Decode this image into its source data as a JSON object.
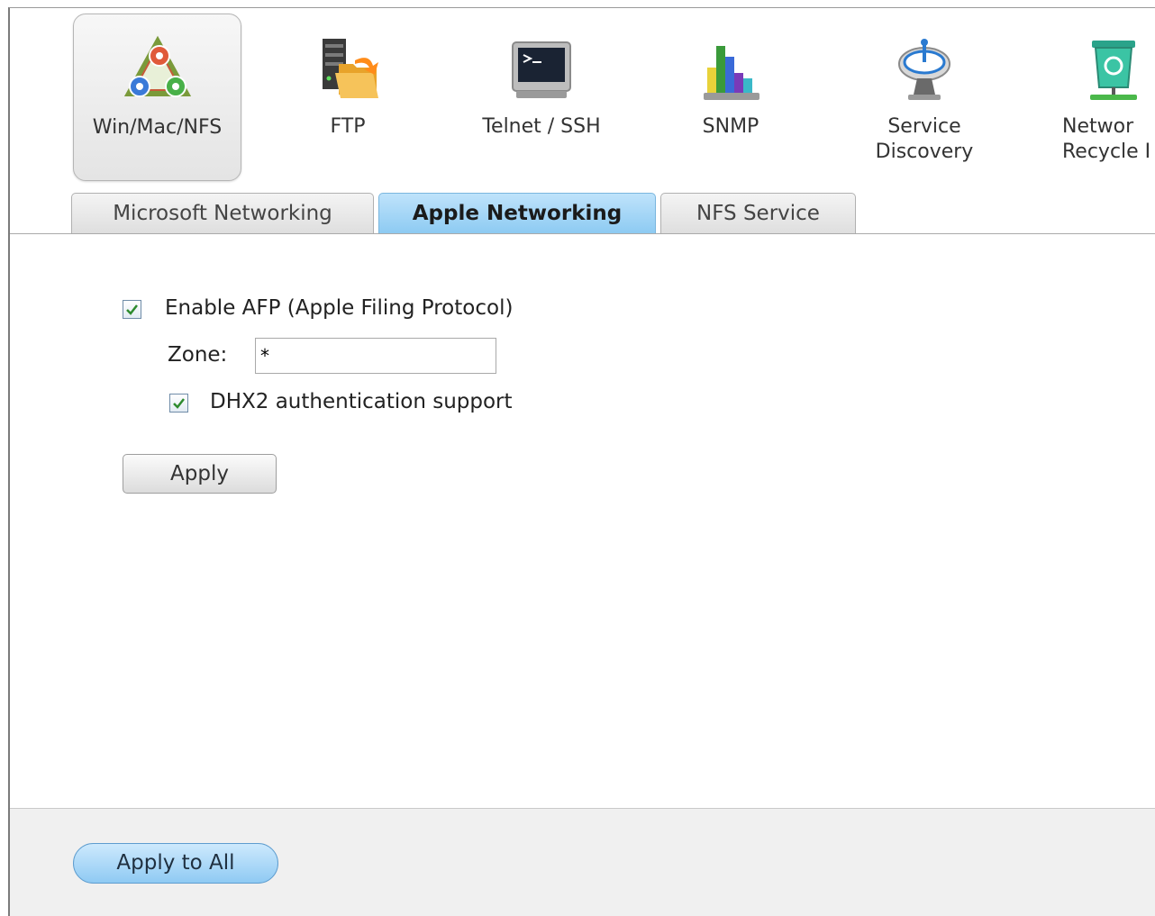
{
  "services": [
    {
      "label": "Win/Mac/NFS",
      "icon": "win-mac-nfs-icon",
      "selected": true
    },
    {
      "label": "FTP",
      "icon": "ftp-folder-icon"
    },
    {
      "label": "Telnet / SSH",
      "icon": "terminal-icon"
    },
    {
      "label": "SNMP",
      "icon": "bar-chart-icon"
    },
    {
      "label": "Service\nDiscovery",
      "icon": "satellite-dish-icon"
    },
    {
      "label": "Networ\nRecycle I",
      "icon": "recycle-bin-icon"
    }
  ],
  "tabs": [
    {
      "label": "Microsoft Networking"
    },
    {
      "label": "Apple Networking",
      "active": true
    },
    {
      "label": "NFS Service"
    }
  ],
  "afp": {
    "enable_label": "Enable AFP (Apple Filing Protocol)",
    "enable_checked": true,
    "zone_label": "Zone:",
    "zone_value": "*",
    "dhx2_label": "DHX2 authentication support",
    "dhx2_checked": true,
    "apply_label": "Apply"
  },
  "footer": {
    "apply_all_label": "Apply to All"
  },
  "colors": {
    "active_tab": "#8ccaf2",
    "checkmark": "#2e8b2e",
    "apply_all": "#8fcaf3"
  }
}
